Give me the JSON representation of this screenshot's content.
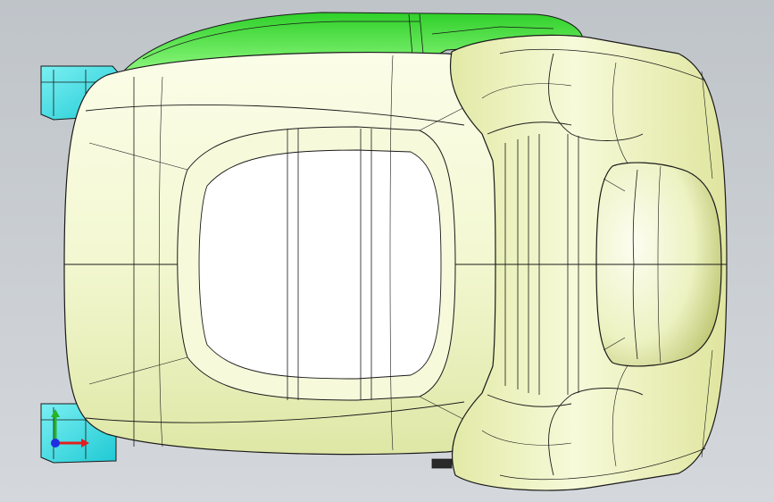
{
  "viewport": {
    "background_top": "#bfc4c9",
    "background_bottom": "#d4d8dc",
    "seat_color": "#eef5c2",
    "seat_highlight": "#fbfde8",
    "seat_shade": "#d9e29a",
    "back_color": "#e9efb4",
    "green_part_color": "#3fe23a",
    "bracket_color": "#46e0e6",
    "edge_color": "#1a1a1a"
  },
  "triad": {
    "x_axis_color": "#e02020",
    "y_axis_color": "#28b428",
    "z_axis_color": "#1e2ee0",
    "icon": "coordinate-triad-icon"
  }
}
